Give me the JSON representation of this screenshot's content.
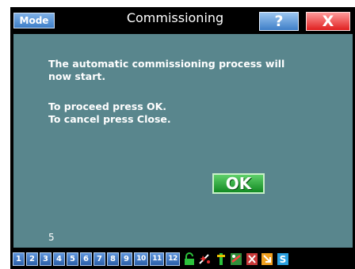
{
  "titlebar": {
    "mode_label": "Mode",
    "title": "Commissioning",
    "help_label": "?",
    "close_label": "X"
  },
  "dialog": {
    "message_line1": "The automatic commissioning process will now start.",
    "message_line2": "To proceed press OK.",
    "message_line3": "To cancel press Close.",
    "ok_label": "OK",
    "counter": "5"
  },
  "taskbar": {
    "channels": [
      "1",
      "2",
      "3",
      "4",
      "5",
      "6",
      "7",
      "8",
      "9",
      "10",
      "11",
      "12"
    ],
    "tool_icons": [
      "lock-open-icon",
      "sparkle-icon",
      "connector-icon",
      "link-icon",
      "disconnect-icon",
      "arrow-icon",
      "s-icon"
    ]
  },
  "colors": {
    "content_bg": "#59868d",
    "mode_button": "#3f7fc8",
    "close_button": "#e02020",
    "ok_button": "#1a9a2a"
  }
}
